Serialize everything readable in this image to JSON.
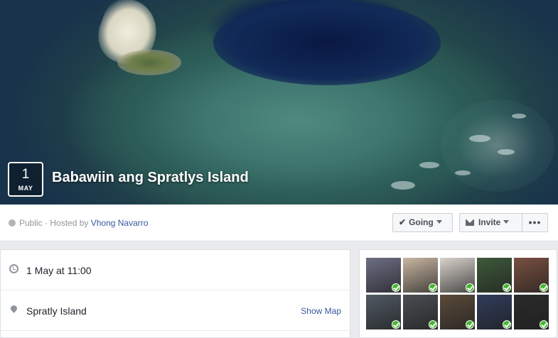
{
  "event": {
    "date_day": "1",
    "date_month": "MAY",
    "title": "Babawiin ang Spratlys Island"
  },
  "host_bar": {
    "privacy_text": "Public · Hosted by ",
    "host_name": "Vhong Navarro"
  },
  "actions": {
    "going_label": "Going",
    "invite_label": "Invite",
    "more_label": "•••"
  },
  "details": {
    "time_text": "1 May at 11:00",
    "location_text": "Spratly Island",
    "show_map_label": "Show Map"
  },
  "guests": {
    "avatars": [
      {
        "name": "guest-avatar-1",
        "color": "#6d6f86",
        "status": "going"
      },
      {
        "name": "guest-avatar-2",
        "color": "#c9b6a1",
        "status": "going"
      },
      {
        "name": "guest-avatar-3",
        "color": "#d9d3cc",
        "status": "going"
      },
      {
        "name": "guest-avatar-4",
        "color": "#3d5a3a",
        "status": "going"
      },
      {
        "name": "guest-avatar-5",
        "color": "#7a5040",
        "status": "going"
      },
      {
        "name": "guest-avatar-6",
        "color": "#505a63",
        "status": "going"
      },
      {
        "name": "guest-avatar-7",
        "color": "#4a4d52",
        "status": "going"
      },
      {
        "name": "guest-avatar-8",
        "color": "#5b4a3a",
        "status": "going"
      },
      {
        "name": "guest-avatar-9",
        "color": "#2f3c5a",
        "status": "going"
      },
      {
        "name": "guest-avatar-10",
        "color": "#2a2a2a",
        "status": "going"
      }
    ]
  },
  "colors": {
    "link": "#365899",
    "going_check": "#42b72a"
  }
}
